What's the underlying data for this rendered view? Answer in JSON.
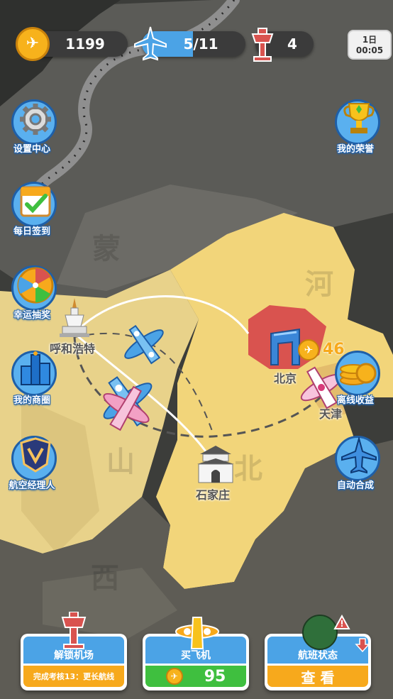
{
  "hud": {
    "coins": "1199",
    "planes": "5/11",
    "towers": "4"
  },
  "clock": {
    "day": "1日",
    "time": "00:05"
  },
  "left_menu": [
    {
      "label": "设置中心",
      "icon": "gear-icon"
    },
    {
      "label": "每日签到",
      "icon": "calendar-check-icon"
    },
    {
      "label": "幸运抽奖",
      "icon": "lucky-wheel-icon"
    },
    {
      "label": "我的商圈",
      "icon": "city-buildings-icon"
    },
    {
      "label": "航空经理人",
      "icon": "manager-emblem-icon"
    }
  ],
  "right_menu": [
    {
      "label": "我的荣誉",
      "icon": "trophy-icon"
    },
    {
      "label": "离线收益",
      "icon": "coin-stack-icon"
    },
    {
      "label": "自动合成",
      "icon": "plane-merge-icon"
    }
  ],
  "map": {
    "cities": [
      {
        "name": "呼和浩特"
      },
      {
        "name": "北京"
      },
      {
        "name": "天津"
      },
      {
        "name": "石家庄"
      }
    ],
    "provinces": [
      "蒙",
      "河",
      "山",
      "北",
      "西"
    ],
    "beijing_income": "46"
  },
  "bottom": {
    "unlock": {
      "title": "解锁机场",
      "subtitle": "完成考核13：更长航线"
    },
    "buy": {
      "title": "买飞机",
      "price": "95"
    },
    "flights": {
      "title": "航班状态",
      "action": "查 看"
    }
  },
  "colors": {
    "accent_blue": "#4ba3e6",
    "green": "#3fbf3f",
    "orange": "#f7a91c",
    "beijing": "#d9534f",
    "map_yellow": "#f2d57a"
  }
}
